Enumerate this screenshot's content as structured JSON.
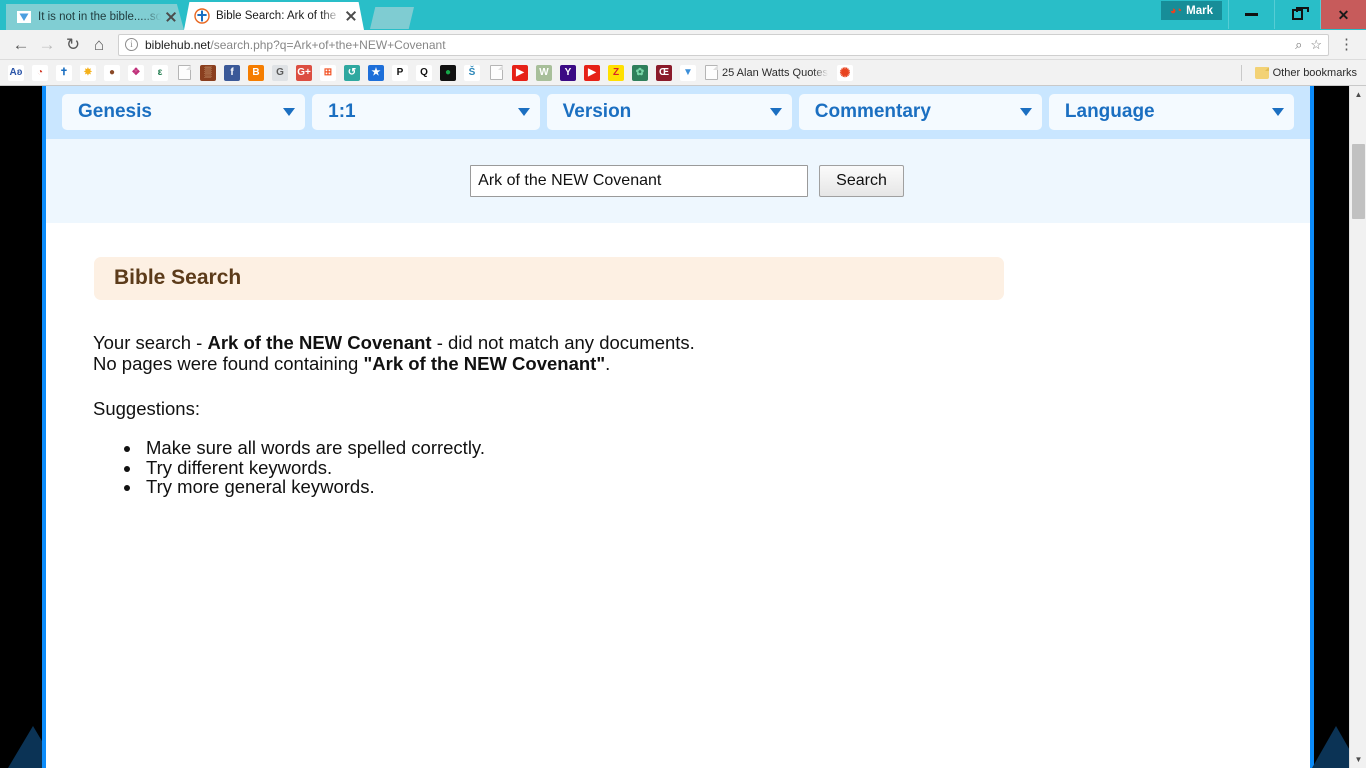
{
  "browser": {
    "tabs": [
      {
        "title": "It is not in the bible.....sol",
        "favicon": "blue-triangle-icon",
        "active": false
      },
      {
        "title": "Bible Search: Ark of the N",
        "favicon": "cross-icon",
        "active": true
      }
    ],
    "new_tab_label": "",
    "profile": {
      "name": "Mark",
      "icon": "person-badge-icon"
    },
    "window_controls": {
      "minimize": "minimize-icon",
      "maximize": "restore-icon",
      "close": "close-icon"
    },
    "nav": {
      "back": "back-arrow-icon",
      "forward": "forward-arrow-icon",
      "reload": "reload-icon",
      "home": "home-icon"
    },
    "omnibox": {
      "info_icon": "info-icon",
      "host": "biblehub.net",
      "path": "/search.php?q=Ark+of+the+NEW+Covenant",
      "zoom_icon": "zoom-search-icon",
      "star_icon": "bookmark-star-icon",
      "menu_icon": "three-dot-menu-icon"
    },
    "bookmarks": {
      "items": [
        {
          "name": "bookmark-ak",
          "glyph": "Aʚ",
          "bg": "#ffffff",
          "fg": "#2b55a8"
        },
        {
          "name": "bookmark-rainbow",
          "glyph": "◔",
          "bg": "#ffffff",
          "fg": "#d23b2a"
        },
        {
          "name": "bookmark-cross",
          "glyph": "✝",
          "bg": "#ffffff",
          "fg": "#1b6fc1"
        },
        {
          "name": "bookmark-starburst",
          "glyph": "✸",
          "bg": "#ffffff",
          "fg": "#f5b21c"
        },
        {
          "name": "bookmark-brown-oval",
          "glyph": "●",
          "bg": "#ffffff",
          "fg": "#8b4a28"
        },
        {
          "name": "bookmark-scroll",
          "glyph": "❖",
          "bg": "#ffffff",
          "fg": "#c0307a"
        },
        {
          "name": "bookmark-epsilon",
          "glyph": "ε",
          "bg": "#ffffff",
          "fg": "#1d7a4c"
        },
        {
          "name": "bookmark-page-1",
          "glyph": "",
          "bg": "page",
          "fg": ""
        },
        {
          "name": "bookmark-brick",
          "glyph": "▒",
          "bg": "#8a3f1f",
          "fg": "#e8c9a0"
        },
        {
          "name": "bookmark-facebook",
          "glyph": "f",
          "bg": "#3b5998",
          "fg": "#ffffff"
        },
        {
          "name": "bookmark-blogger",
          "glyph": "B",
          "bg": "#f57d00",
          "fg": "#ffffff"
        },
        {
          "name": "bookmark-grey-g",
          "glyph": "G",
          "bg": "#dfe2e5",
          "fg": "#5b5b5b"
        },
        {
          "name": "bookmark-google-plus",
          "glyph": "G+",
          "bg": "#dc4e41",
          "fg": "#ffffff"
        },
        {
          "name": "bookmark-microsoft",
          "glyph": "⊞",
          "bg": "#ffffff",
          "fg": "#f25022"
        },
        {
          "name": "bookmark-teal-swirl",
          "glyph": "↺",
          "bg": "#2fa8a0",
          "fg": "#ffffff"
        },
        {
          "name": "bookmark-blue-star",
          "glyph": "★",
          "bg": "#1e6fd9",
          "fg": "#ffffff"
        },
        {
          "name": "bookmark-p",
          "glyph": "P",
          "bg": "#ffffff",
          "fg": "#111111"
        },
        {
          "name": "bookmark-q",
          "glyph": "Q",
          "bg": "#ffffff",
          "fg": "#111111"
        },
        {
          "name": "bookmark-green-dot",
          "glyph": "●",
          "bg": "#111111",
          "fg": "#17a84a"
        },
        {
          "name": "bookmark-sb",
          "glyph": "Š",
          "bg": "#ffffff",
          "fg": "#2b86b8"
        },
        {
          "name": "bookmark-page-2",
          "glyph": "",
          "bg": "page",
          "fg": ""
        },
        {
          "name": "bookmark-youtube-1",
          "glyph": "▶",
          "bg": "#e62117",
          "fg": "#ffffff"
        },
        {
          "name": "bookmark-wh",
          "glyph": "W",
          "bg": "#a8bf9a",
          "fg": "#ffffff"
        },
        {
          "name": "bookmark-yahoo",
          "glyph": "Y",
          "bg": "#3b0a84",
          "fg": "#ffffff"
        },
        {
          "name": "bookmark-youtube-2",
          "glyph": "▶",
          "bg": "#e62117",
          "fg": "#ffffff"
        },
        {
          "name": "bookmark-zz",
          "glyph": "Z",
          "bg": "#ffe000",
          "fg": "#d8242a"
        },
        {
          "name": "bookmark-peacock",
          "glyph": "✿",
          "bg": "#2f7f5b",
          "fg": "#79d6a8"
        },
        {
          "name": "bookmark-oe",
          "glyph": "Œ",
          "bg": "#8b1b2a",
          "fg": "#ffffff"
        },
        {
          "name": "bookmark-blue-triangle",
          "glyph": "▼",
          "bg": "#ffffff",
          "fg": "#3c8fd9"
        }
      ],
      "labeled": {
        "label": "25 Alan Watts Quotes",
        "icon": "page-icon"
      },
      "last": {
        "name": "bookmark-orange-circle",
        "glyph": "✺",
        "bg": "#ffffff",
        "fg": "#e8431f"
      },
      "other": {
        "label": "Other bookmarks",
        "icon": "folder-icon"
      }
    },
    "scrollbar": {
      "up": "scroll-up-arrow-icon",
      "down": "scroll-down-arrow-icon"
    }
  },
  "page": {
    "dropdowns": [
      {
        "name": "book-select",
        "label": "Genesis"
      },
      {
        "name": "verse-select",
        "label": "1:1"
      },
      {
        "name": "version-select",
        "label": "Version"
      },
      {
        "name": "commentary-select",
        "label": "Commentary"
      },
      {
        "name": "language-select",
        "label": "Language"
      }
    ],
    "search": {
      "value": "Ark of the NEW Covenant",
      "placeholder": "",
      "button_label": "Search"
    },
    "heading": "Bible Search",
    "results": {
      "line1_prefix": "Your search - ",
      "query": "Ark of the NEW Covenant",
      "line1_suffix": " - did not match any documents.",
      "line2_prefix": "No pages were found containing ",
      "quoted_query": "\"Ark of the NEW Covenant\"",
      "line2_suffix": ".",
      "suggestions_label": "Suggestions:",
      "suggestions": [
        "Make sure all words are spelled correctly.",
        "Try different keywords.",
        "Try more general keywords."
      ]
    }
  },
  "colors": {
    "titlebar_teal": "#29bec8",
    "page_border_blue": "#0c8cfa",
    "nav_band_blue": "#c9e6ff",
    "search_band_blue": "#eef7fe",
    "heading_bg": "#fdf0e3",
    "heading_fg": "#5c3b1a",
    "dropdown_text": "#1b6fc1"
  }
}
